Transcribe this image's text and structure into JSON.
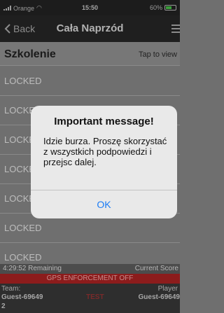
{
  "status_bar": {
    "carrier": "Orange",
    "time": "15:50",
    "battery": "60%",
    "battery_level": 0.6
  },
  "nav": {
    "back_label": "Back",
    "title": "Cała Naprzód"
  },
  "header": {
    "title": "Szkolenie",
    "tap_label": "Tap to view"
  },
  "list": {
    "items": [
      "LOCKED",
      "LOCKED",
      "LOCKED",
      "LOCKED",
      "LOCKED",
      "LOCKED",
      "LOCKED"
    ]
  },
  "bottom": {
    "remaining": "4:29:52 Remaining",
    "current_score": "Current Score",
    "gps": "GPS ENFORCEMENT OFF",
    "team_label": "Team:",
    "team_name": "Guest-69649",
    "team_num": "2",
    "test_label": "TEST",
    "player_label": "Player",
    "player_name": "Guest-69649"
  },
  "alert": {
    "title": "Important message!",
    "message": "Idzie burza. Proszę skorzystać z wszystkich podpowiedzi i przejsc dalej.",
    "ok": "OK"
  },
  "colors": {
    "accent": "#1a7cf5",
    "gps_bar": "#8c1c1c",
    "battery": "#3b9e3b"
  }
}
